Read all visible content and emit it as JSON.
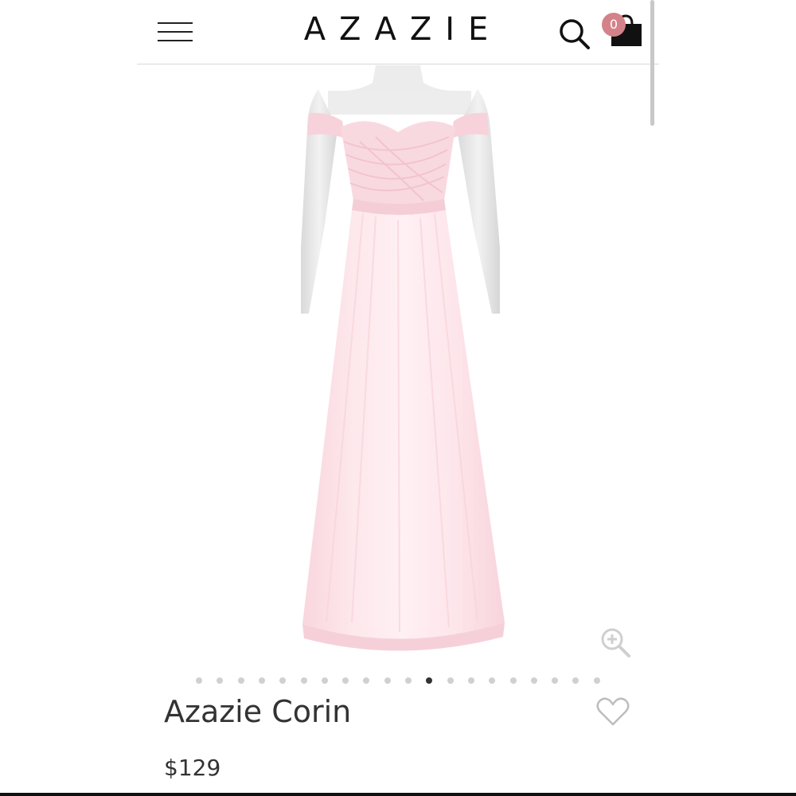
{
  "header": {
    "brand": "AZAZIE",
    "menu_icon": "hamburger-menu-icon",
    "search_icon": "search-icon",
    "cart_icon": "shopping-bag-icon",
    "cart_count": "0",
    "cart_badge_color": "#d4828a"
  },
  "product": {
    "name": "Azazie Corin",
    "price": "$129",
    "dress_color": "#fbe0e6",
    "zoom_icon": "zoom-in-icon",
    "wishlist_icon": "heart-outline-icon"
  },
  "carousel": {
    "total_slides": 20,
    "active_index": 11
  }
}
